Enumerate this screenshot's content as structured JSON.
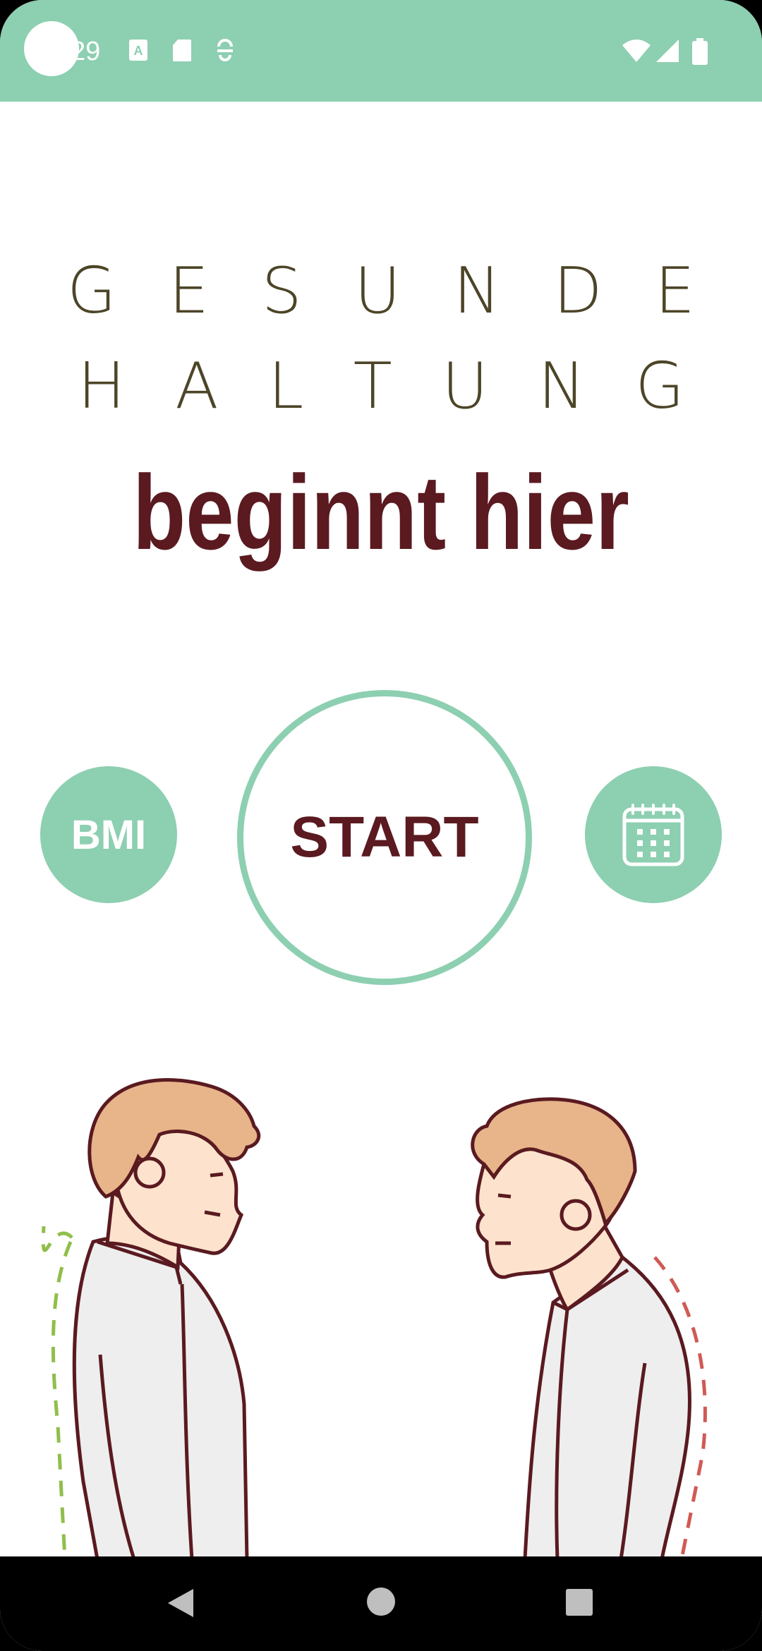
{
  "status_bar": {
    "time": "29",
    "icons": [
      "text-a-icon",
      "sd-card-icon",
      "vpn-icon",
      "wifi-icon",
      "signal-icon",
      "battery-icon"
    ]
  },
  "headline": {
    "line1": [
      "G",
      "E",
      "S",
      "U",
      "N",
      "D",
      "E"
    ],
    "line2": [
      "H",
      "A",
      "L",
      "T",
      "U",
      "N",
      "G"
    ],
    "line3": "beginnt hier"
  },
  "buttons": {
    "bmi": "BMI",
    "start": "START",
    "calendar_icon": "calendar-icon"
  },
  "illustration": {
    "good_posture": "person-upright",
    "bad_posture": "person-hunched"
  },
  "nav": {
    "back": "back-icon",
    "home": "home-icon",
    "recents": "recents-icon"
  },
  "colors": {
    "accent": "#8dcfb1",
    "heading": "#4d4528",
    "brand_dark_red": "#5a1a20",
    "good_line": "#8fbf4a",
    "bad_line": "#d05a55"
  }
}
